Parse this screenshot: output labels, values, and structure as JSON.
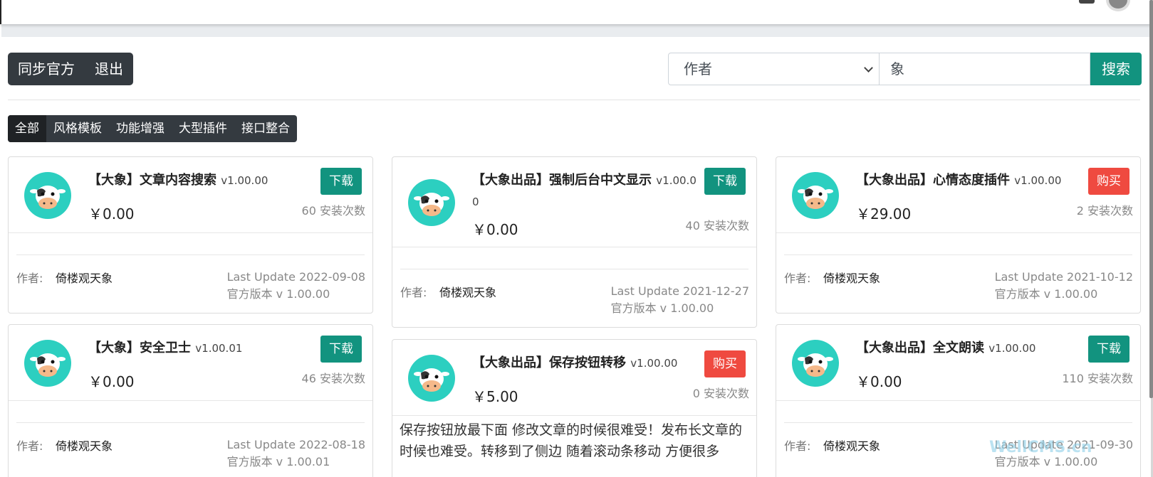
{
  "toolbar": {
    "sync_label": "同步官方",
    "logout_label": "退出"
  },
  "search": {
    "field_selected": "作者",
    "query": "象",
    "button_label": "搜索"
  },
  "categories": [
    "全部",
    "风格模板",
    "功能增强",
    "大型插件",
    "接口整合"
  ],
  "labels": {
    "author_prefix": "作者:"
  },
  "cards": [
    {
      "title": "【大象】文章内容搜索",
      "version": "v1.00.00",
      "price": "￥0.00",
      "action": "下载",
      "installs": "60 安装次数",
      "author": "倚楼观天象",
      "last_update": "Last Update 2022-09-08",
      "official_version": "官方版本 v 1.00.00"
    },
    {
      "title": "【大象出品】强制后台中文显示",
      "version": "v1.00.00",
      "price": "￥0.00",
      "action": "下载",
      "installs": "40 安装次数",
      "author": "倚楼观天象",
      "last_update": "Last Update 2021-12-27",
      "official_version": "官方版本 v 1.00.00"
    },
    {
      "title": "【大象出品】心情态度插件",
      "version": "v1.00.00",
      "price": "￥29.00",
      "action": "购买",
      "installs": "2 安装次数",
      "author": "倚楼观天象",
      "last_update": "Last Update 2021-10-12",
      "official_version": "官方版本 v 1.00.00"
    },
    {
      "title": "【大象】安全卫士",
      "version": "v1.00.01",
      "price": "￥0.00",
      "action": "下载",
      "installs": "46 安装次数",
      "author": "倚楼观天象",
      "last_update": "Last Update 2022-08-18",
      "official_version": "官方版本 v 1.00.01"
    },
    {
      "title": "【大象出品】保存按钮转移",
      "version": "v1.00.00",
      "price": "￥5.00",
      "action": "购买",
      "installs": "0 安装次数",
      "description": "保存按钮放最下面 修改文章的时候很难受！发布长文章的时候也难受。转移到了侧边 随着滚动条移动 方便很多"
    },
    {
      "title": "【大象出品】全文朗读",
      "version": "v1.00.00",
      "price": "￥0.00",
      "action": "下载",
      "installs": "110 安装次数",
      "author": "倚楼观天象",
      "last_update": "Last Update 2021-09-30",
      "official_version": "官方版本 v 1.00.00"
    }
  ],
  "watermark": "WellCMS.cn",
  "colors": {
    "primary": "#12937f",
    "danger": "#ef4a40",
    "dark": "#343a40"
  }
}
